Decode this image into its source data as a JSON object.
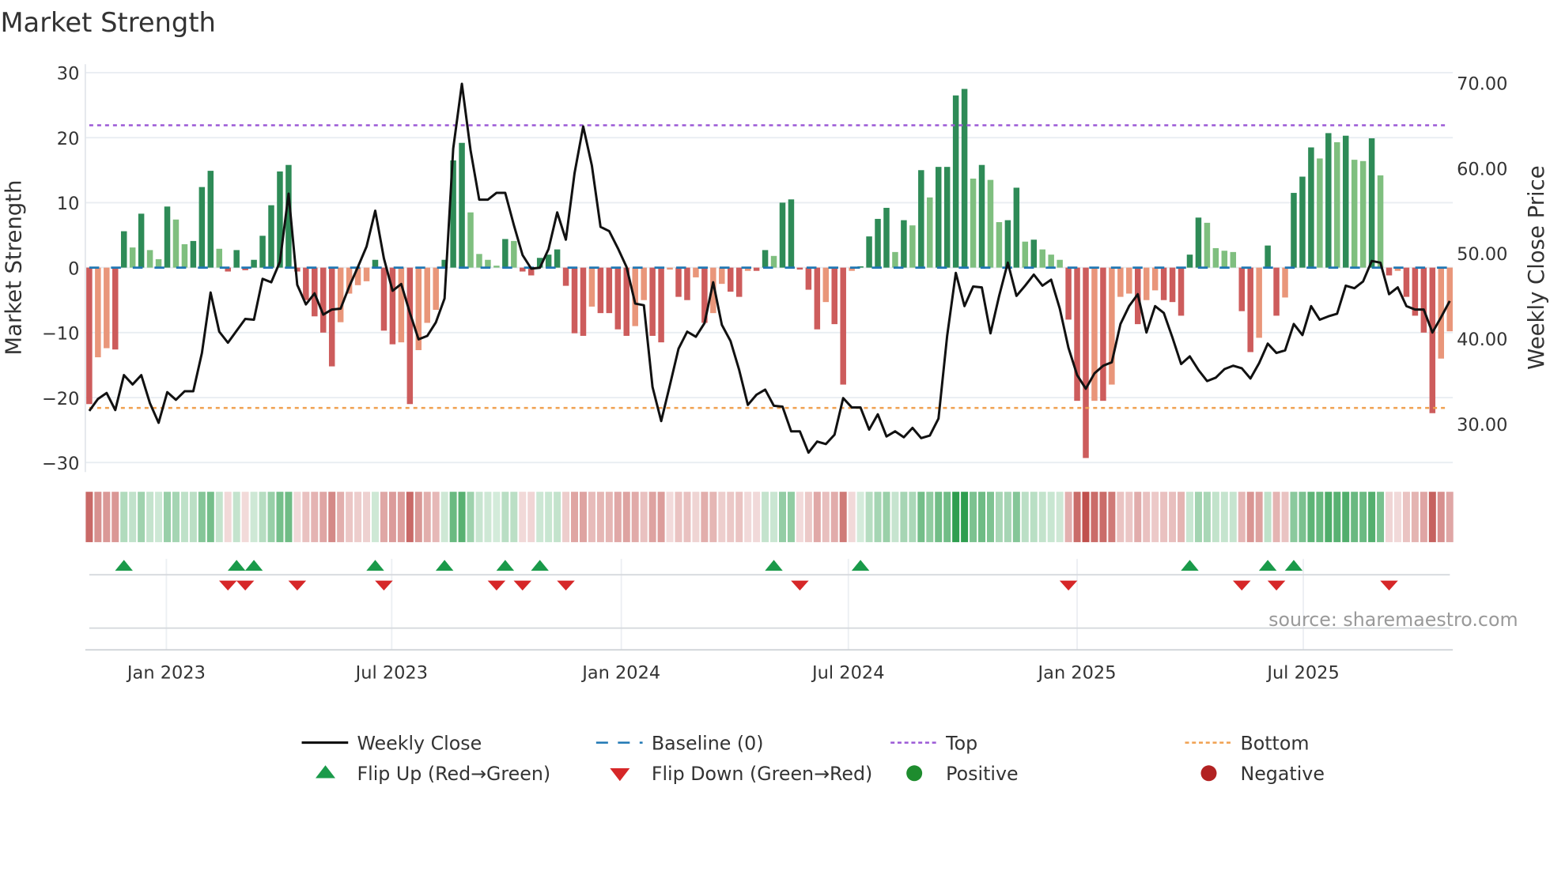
{
  "title": "Market Strength",
  "source": "source: sharemaestro.com",
  "colors": {
    "strong_green": "#2e8b57",
    "weak_green": "#7fbf7f",
    "strong_red": "#cd5c5c",
    "weak_red": "#e9967a",
    "baseline": "#1f77b4",
    "top": "#9b59d6",
    "bottom": "#f0a050",
    "flip_up": "#1a9a4a",
    "flip_down": "#d62728",
    "positive": "#1e8c2e",
    "negative": "#b22222",
    "line": "#111111"
  },
  "legend": [
    {
      "label": "Weekly Close",
      "kind": "line"
    },
    {
      "label": "Baseline (0)",
      "kind": "baseline"
    },
    {
      "label": "Top",
      "kind": "top"
    },
    {
      "label": "Bottom",
      "kind": "bottom"
    },
    {
      "label": "Flip Up (Red→Green)",
      "kind": "flip_up"
    },
    {
      "label": "Flip Down (Green→Red)",
      "kind": "flip_down"
    },
    {
      "label": "Positive",
      "kind": "positive"
    },
    {
      "label": "Negative",
      "kind": "negative"
    }
  ],
  "chart_data": {
    "type": "bar",
    "title": "Market Strength",
    "ylabel": "Market Strength",
    "y2label": "Weekly Close Price",
    "ylim": [
      -30,
      30
    ],
    "y2lim": [
      25,
      72
    ],
    "yticks": [
      "30",
      "20",
      "10",
      "0",
      "−10",
      "−20",
      "−30"
    ],
    "ytick_values": [
      30,
      20,
      10,
      0,
      -10,
      -20,
      -30
    ],
    "y2ticks": [
      "70.00",
      "60.00",
      "50.00",
      "40.00",
      "30.00"
    ],
    "y2tick_values": [
      70,
      60,
      50,
      40,
      30
    ],
    "xticks": [
      {
        "label": "Jan 2023",
        "week": 8.9
      },
      {
        "label": "Jul 2023",
        "week": 34.9
      },
      {
        "label": "Jan 2024",
        "week": 61.4
      },
      {
        "label": "Jul 2024",
        "week": 87.6
      },
      {
        "label": "Jan 2025",
        "week": 114
      },
      {
        "label": "Jul 2025",
        "week": 140.1
      }
    ],
    "top_level": 21.9,
    "bottom_level": -21.6,
    "strength": [
      -21,
      -13.8,
      -12.4,
      -12.6,
      5.6,
      3.1,
      8.3,
      2.7,
      1.3,
      9.4,
      7.4,
      3.6,
      4.1,
      12.4,
      14.9,
      2.9,
      -0.6,
      2.7,
      -0.4,
      1.2,
      4.9,
      9.6,
      14.8,
      15.8,
      -0.6,
      -5,
      -7.5,
      -10,
      -15.2,
      -8.4,
      -4,
      -2.7,
      -2.1,
      1.2,
      -9.7,
      -11.8,
      -11.5,
      -21,
      -12.7,
      -8.5,
      -6.5,
      1.2,
      16.5,
      19.2,
      8.5,
      2.1,
      1.2,
      0.3,
      4.4,
      4.1,
      -0.6,
      -1.2,
      1.5,
      2.0,
      2.8,
      -2.8,
      -10.1,
      -10.5,
      -6,
      -7,
      -7,
      -9.5,
      -10.5,
      -9,
      -5,
      -10.5,
      -11.5,
      -0.3,
      -4.5,
      -5,
      -1.5,
      -8.5,
      -7,
      -2.5,
      -3.7,
      -4.5,
      -0.5,
      -0.5,
      2.7,
      1.8,
      10,
      10.5,
      -0.3,
      -3.4,
      -9.5,
      -5.3,
      -8.7,
      -18,
      -0.5,
      0.2,
      4.8,
      7.5,
      9.2,
      2.4,
      7.3,
      6.5,
      15,
      10.8,
      15.5,
      15.5,
      26.5,
      27.5,
      13.7,
      15.8,
      13.5,
      7,
      7.3,
      12.3,
      4,
      4.3,
      2.8,
      2,
      1.2,
      -8,
      -20.5,
      -29.3,
      -20.5,
      -20.5,
      -18,
      -4.5,
      -4,
      -8.7,
      -5,
      -3.5,
      -5,
      -5.3,
      -7.4,
      2,
      7.7,
      6.9,
      3,
      2.6,
      2.4,
      -6.7,
      -13,
      -10.8,
      3.4,
      -7.4,
      -4.6,
      11.5,
      14,
      18.5,
      16.8,
      20.7,
      19.3,
      20.3,
      16.6,
      16.4,
      19.9,
      14.2,
      -1.2,
      -0.5,
      -4.5,
      -7.4,
      -10,
      -22.4,
      -14,
      -9.8
    ],
    "weekly_close": [
      31.5,
      32.9,
      33.6,
      31.6,
      35.7,
      34.6,
      35.7,
      32.4,
      30.1,
      33.7,
      32.8,
      33.8,
      33.8,
      38.3,
      45.4,
      40.8,
      39.5,
      40.9,
      42.3,
      42.2,
      47.0,
      46.6,
      49,
      57,
      46.3,
      44,
      45.3,
      42.8,
      43.4,
      43.5,
      46.1,
      48.4,
      50.8,
      55,
      49.4,
      45.6,
      46.4,
      43,
      39.9,
      40.3,
      41.9,
      44.7,
      62.3,
      69.9,
      62.1,
      56.3,
      56.3,
      57.1,
      57.1,
      53.3,
      49.8,
      48.2,
      48.3,
      50.5,
      54.8,
      51.6,
      59.4,
      64.9,
      60.3,
      53.1,
      52.6,
      50.6,
      48.4,
      44.1,
      43.9,
      34.3,
      30.3,
      34.5,
      38.8,
      40.8,
      40.2,
      41.8,
      46.6,
      41.6,
      39.7,
      36.3,
      32.2,
      33.4,
      34,
      32.1,
      32,
      29.1,
      29.1,
      26.6,
      27.9,
      27.6,
      28.7,
      33,
      31.9,
      31.9,
      29.3,
      31.1,
      28.5,
      29.1,
      28.4,
      29.5,
      28.3,
      28.6,
      30.6,
      40.3,
      47.7,
      43.8,
      46.1,
      46,
      40.6,
      45,
      48.9,
      45,
      46.2,
      47.5,
      46.2,
      46.9,
      43.5,
      38.9,
      35.7,
      34.1,
      35.9,
      36.8,
      37.2,
      41.7,
      43.8,
      45.2,
      40.7,
      43.8,
      43,
      40.1,
      37,
      37.9,
      36.3,
      35,
      35.4,
      36.4,
      36.8,
      36.5,
      35.3,
      37.1,
      39.4,
      38.3,
      38.6,
      41.7,
      40.4,
      43.8,
      42.2,
      42.6,
      42.9,
      46.2,
      45.9,
      46.7,
      49.1,
      48.9,
      45.2,
      46,
      43.8,
      43.4,
      43.4,
      40.7,
      42.5,
      44.4
    ],
    "flip_up_weeks": [
      4,
      17,
      19,
      33,
      41,
      48,
      52,
      79,
      89,
      127,
      136,
      139
    ],
    "flip_down_weeks": [
      16,
      18,
      24,
      34,
      47,
      50,
      55,
      82,
      113,
      133,
      137,
      150
    ],
    "legend_position": "bottom"
  }
}
